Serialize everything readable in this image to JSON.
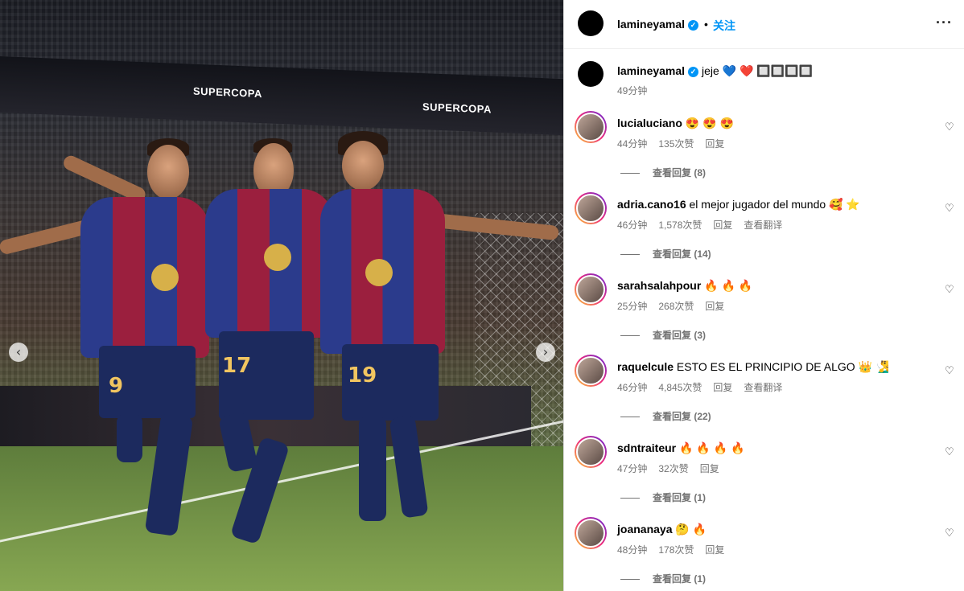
{
  "post": {
    "username": "lamineyamal",
    "follow_label": "关注",
    "dot": "•",
    "more_icon": "more-horizontal-icon"
  },
  "caption": {
    "username": "lamineyamal",
    "text": "jeje 💙 ❤️ 🔲🔲🔲🔲",
    "time": "49分钟"
  },
  "media": {
    "banner_text": "SUPERCOPA",
    "prev_icon": "chevron-left-icon",
    "next_icon": "chevron-right-icon",
    "numbers": [
      "9",
      "17",
      "19"
    ]
  },
  "comments": [
    {
      "username": "lucialuciano",
      "text": "😍 😍 😍",
      "time": "44分钟",
      "likes": "135次赞",
      "reply": "回复",
      "translate": "",
      "view_replies": "查看回复 (8)"
    },
    {
      "username": "adria.cano16",
      "text": "el mejor jugador del mundo 🥰 ⭐",
      "time": "46分钟",
      "likes": "1,578次赞",
      "reply": "回复",
      "translate": "查看翻译",
      "view_replies": "查看回复 (14)"
    },
    {
      "username": "sarahsalahpour",
      "text": "🔥 🔥 🔥",
      "time": "25分钟",
      "likes": "268次赞",
      "reply": "回复",
      "translate": "",
      "view_replies": "查看回复 (3)"
    },
    {
      "username": "raquelcule",
      "text": "ESTO ES EL PRINCIPIO DE ALGO 👑 🧏‍♂️",
      "time": "46分钟",
      "likes": "4,845次赞",
      "reply": "回复",
      "translate": "查看翻译",
      "view_replies": "查看回复 (22)"
    },
    {
      "username": "sdntraiteur",
      "text": "🔥 🔥 🔥 🔥",
      "time": "47分钟",
      "likes": "32次赞",
      "reply": "回复",
      "translate": "",
      "view_replies": "查看回复 (1)"
    },
    {
      "username": "joananaya",
      "text": "🤔 🔥",
      "time": "48分钟",
      "likes": "178次赞",
      "reply": "回复",
      "translate": "",
      "view_replies": "查看回复 (1)"
    }
  ],
  "heart_glyph": "♡",
  "check_glyph": "✓",
  "colors": {
    "link": "#0095f6",
    "meta": "#737373",
    "border": "#dbdbdb"
  }
}
